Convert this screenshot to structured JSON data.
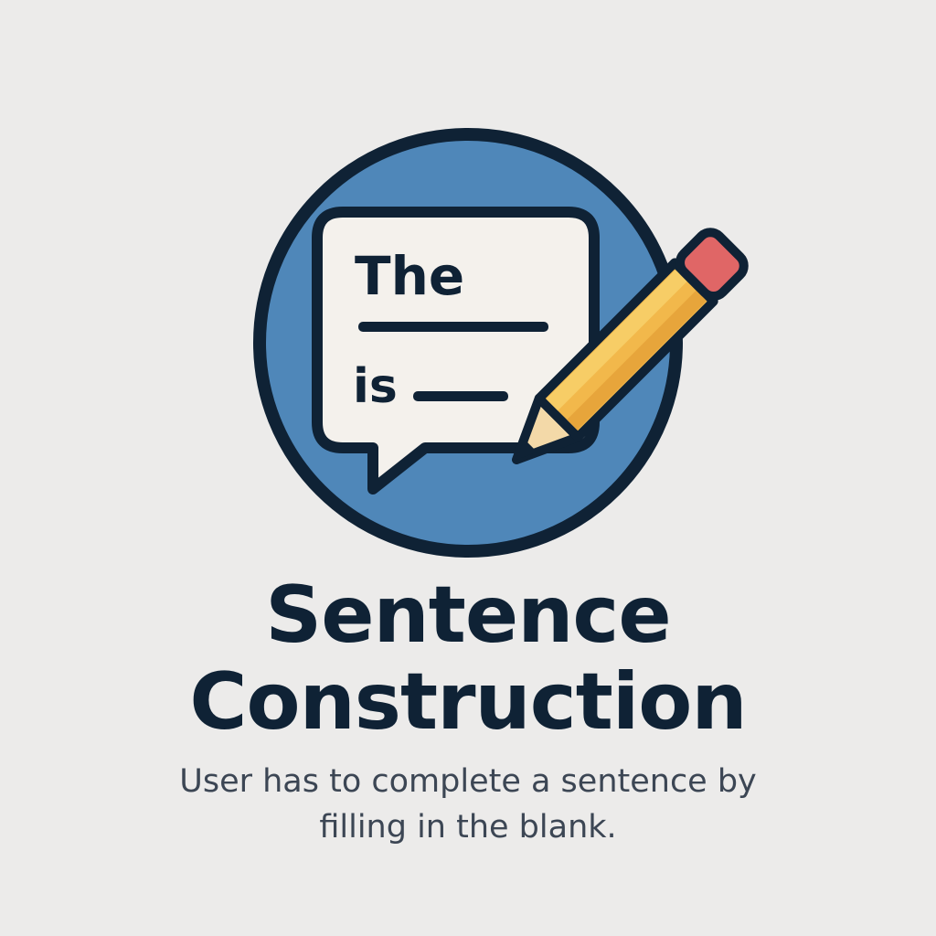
{
  "icon": {
    "name": "speech-bubble-pencil-icon",
    "bubble_word_1": "The",
    "bubble_word_2": "is",
    "colors": {
      "circle": "#4f87b9",
      "outline": "#0f2235",
      "bubble": "#f4f1ec",
      "pencil_body": "#f2b84b",
      "pencil_eraser": "#e06666",
      "pencil_wood": "#f3d9a8"
    }
  },
  "title_line_1": "Sentence",
  "title_line_2": "Construction",
  "subtitle_line_1": "User has to complete a sentence by",
  "subtitle_line_2": "filling in the blank.",
  "colors": {
    "background": "#ecebea",
    "title": "#0f2235",
    "subtitle": "#3c4654"
  }
}
